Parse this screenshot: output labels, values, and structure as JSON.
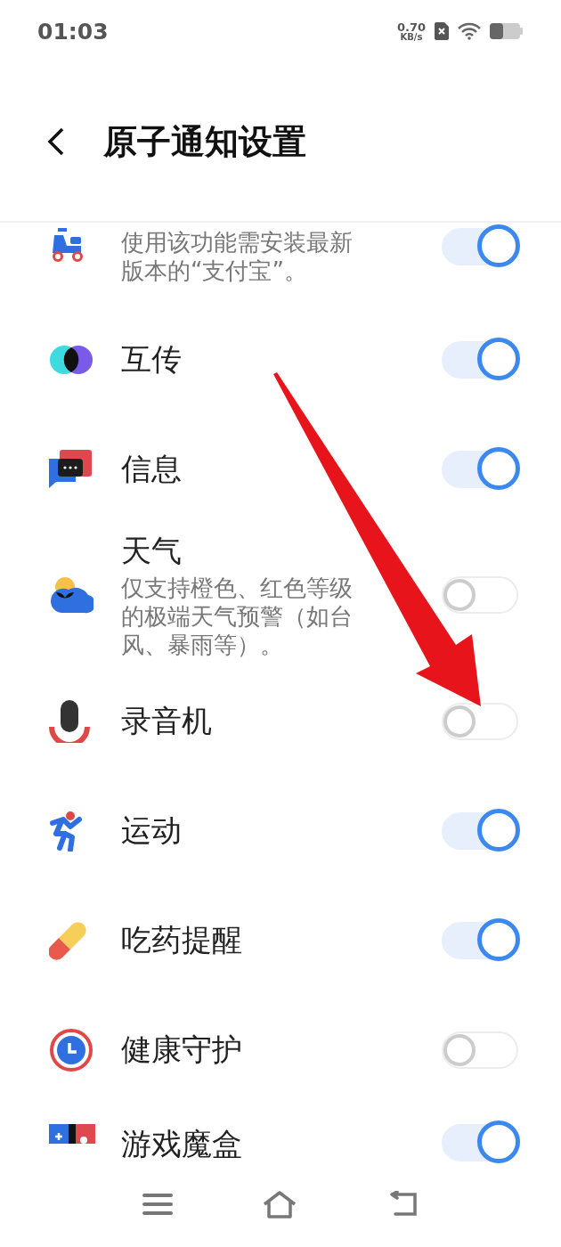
{
  "status_bar": {
    "time": "01:03",
    "speed_value": "0.70",
    "speed_unit": "KB/s"
  },
  "header": {
    "title": "原子通知设置"
  },
  "items": [
    {
      "description": "使用该功能需安装最新版本的“支付宝”。",
      "on": true
    },
    {
      "title": "互传",
      "on": true
    },
    {
      "title": "信息",
      "on": true
    },
    {
      "title": "天气",
      "description": "仅支持橙色、红色等级的极端天气预警（如台风、暴雨等）。",
      "on": false
    },
    {
      "title": "录音机",
      "on": false
    },
    {
      "title": "运动",
      "on": true
    },
    {
      "title": "吃药提醒",
      "on": true
    },
    {
      "title": "健康守护",
      "on": false
    },
    {
      "title": "游戏魔盒",
      "on": true
    }
  ]
}
